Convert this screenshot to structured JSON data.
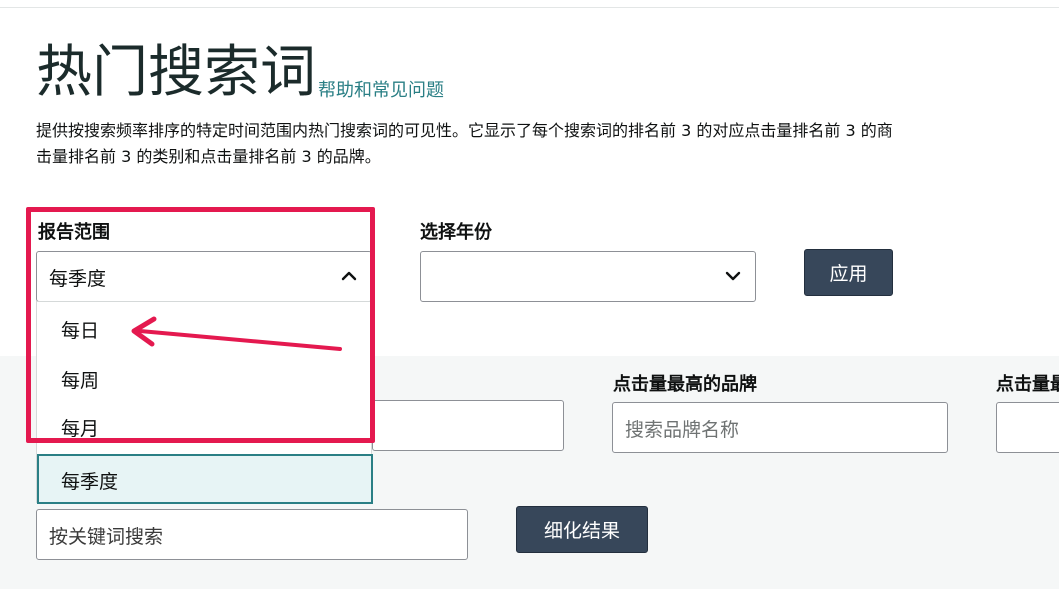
{
  "header": {
    "title": "热门搜索词",
    "help_link": "帮助和常见问题"
  },
  "description": {
    "line1": "提供按搜索频率排序的特定时间范围内热门搜索词的可见性。它显示了每个搜索词的排名前 3 的对应点击量排名前 3 的商",
    "line2": "击量排名前 3 的类别和点击量排名前 3 的品牌。"
  },
  "report_range": {
    "label": "报告范围",
    "value": "每季度",
    "options": [
      "每日",
      "每周",
      "每月",
      "每季度"
    ]
  },
  "year_select": {
    "label": "选择年份",
    "value": ""
  },
  "apply_button": "应用",
  "filters": {
    "brand_label": "点击量最高的品牌",
    "brand_placeholder": "搜索品牌名称",
    "third_label": "点击量最"
  },
  "keyword_search": {
    "placeholder": "按关键词搜索"
  },
  "refine_button": "细化结果",
  "colors": {
    "accent": "#2a7f85",
    "button": "#37475a",
    "highlight": "#e4194f"
  }
}
